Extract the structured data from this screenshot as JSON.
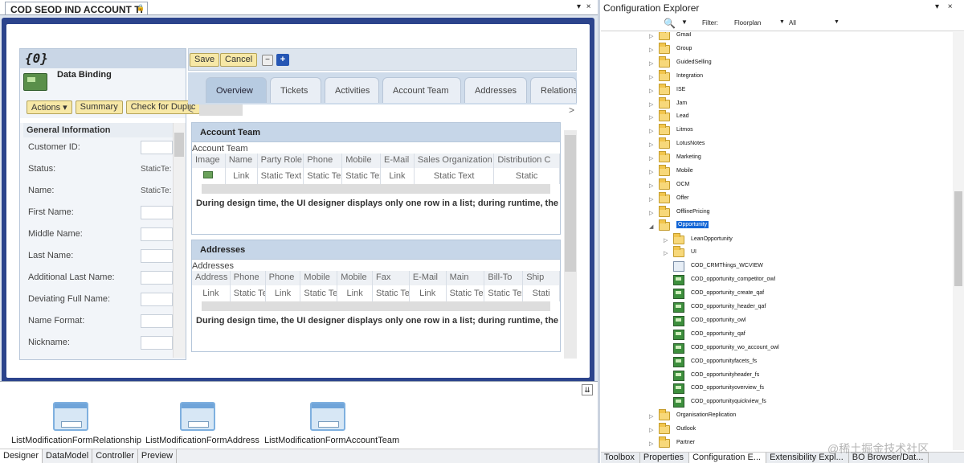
{
  "doc_tab": {
    "title": "COD SEOD IND ACCOUNT TI",
    "pin": "🔒"
  },
  "doc_controls": "▾ ×",
  "binding": {
    "header": "{0}",
    "title": "Data Binding",
    "actions": [
      "Actions ▾",
      "Summary",
      "Check for Duplic"
    ],
    "section": "General Information",
    "fields": [
      {
        "label": "Customer ID:",
        "kind": "box",
        "value": ""
      },
      {
        "label": "Status:",
        "kind": "static",
        "value": "StaticTe:"
      },
      {
        "label": "Name:",
        "kind": "static",
        "value": "StaticTe:"
      },
      {
        "label": "First Name:",
        "kind": "box",
        "value": ""
      },
      {
        "label": "Middle Name:",
        "kind": "box",
        "value": ""
      },
      {
        "label": "Last Name:",
        "kind": "box",
        "value": ""
      },
      {
        "label": "Additional Last Name:",
        "kind": "box",
        "value": ""
      },
      {
        "label": "Deviating Full Name:",
        "kind": "box",
        "value": ""
      },
      {
        "label": "Name Format:",
        "kind": "box",
        "value": ""
      },
      {
        "label": "Nickname:",
        "kind": "box",
        "value": ""
      }
    ]
  },
  "toolbar": {
    "save": "Save",
    "cancel": "Cancel",
    "minus": "−",
    "plus": "+"
  },
  "tabs": [
    "Overview",
    "Tickets",
    "Activities",
    "Account Team",
    "Addresses",
    "Relationsh"
  ],
  "tab_nav": {
    "left": "<",
    "right": ">"
  },
  "account_team": {
    "heading": "Account Team",
    "sub": "Account Team",
    "columns": [
      "Image",
      "Name",
      "Party Role",
      "Phone",
      "Mobile",
      "E-Mail",
      "Sales Organization",
      "Distribution C"
    ],
    "row": [
      "",
      "Link",
      "Static Text",
      "Static Text",
      "Static Text",
      "Link",
      "Static Text",
      "Static"
    ],
    "note": "During design time, the UI designer displays only one row in a list; during runtime, the syst"
  },
  "addresses": {
    "heading": "Addresses",
    "sub": "Addresses",
    "columns": [
      "Address",
      "Phone",
      "Phone",
      "Mobile",
      "Mobile",
      "Fax",
      "E-Mail",
      "Main",
      "Bill-To",
      "Ship"
    ],
    "row": [
      "Link",
      "Static Text",
      "Link",
      "Static Text",
      "Link",
      "Static Text",
      "Link",
      "Static Text",
      "Static Text",
      "Stati"
    ],
    "note": "During design time, the UI designer displays only one row in a list; during runtime, the syst"
  },
  "components": [
    "ListModificationFormRelationship",
    "ListModificationFormAddress",
    "ListModificationFormAccountTeam"
  ],
  "bottom_tabs": [
    "Designer",
    "DataModel",
    "Controller",
    "Preview"
  ],
  "explorer": {
    "title": "Configuration Explorer",
    "controls": "▾ ×",
    "search_icon": "🔍",
    "filter_label": "Filter:",
    "filter_value": "Floorplan",
    "filter2_value": "All",
    "tree": [
      {
        "label": "Gmail",
        "type": "folder",
        "level": 0,
        "tri": "▷"
      },
      {
        "label": "Group",
        "type": "folder",
        "level": 0,
        "tri": "▷"
      },
      {
        "label": "GuidedSelling",
        "type": "folder",
        "level": 0,
        "tri": "▷"
      },
      {
        "label": "Integration",
        "type": "folder",
        "level": 0,
        "tri": "▷"
      },
      {
        "label": "ISE",
        "type": "folder",
        "level": 0,
        "tri": "▷"
      },
      {
        "label": "Jam",
        "type": "folder",
        "level": 0,
        "tri": "▷"
      },
      {
        "label": "Lead",
        "type": "folder",
        "level": 0,
        "tri": "▷"
      },
      {
        "label": "Litmos",
        "type": "folder",
        "level": 0,
        "tri": "▷"
      },
      {
        "label": "LotusNotes",
        "type": "folder",
        "level": 0,
        "tri": "▷"
      },
      {
        "label": "Marketing",
        "type": "folder",
        "level": 0,
        "tri": "▷"
      },
      {
        "label": "Mobile",
        "type": "folder",
        "level": 0,
        "tri": "▷"
      },
      {
        "label": "OCM",
        "type": "folder",
        "level": 0,
        "tri": "▷"
      },
      {
        "label": "Offer",
        "type": "folder",
        "level": 0,
        "tri": "▷"
      },
      {
        "label": "OfflinePricing",
        "type": "folder",
        "level": 0,
        "tri": "▷"
      },
      {
        "label": "Opportunity",
        "type": "folder",
        "level": 0,
        "tri": "◢",
        "selected": true
      },
      {
        "label": "LeanOpportunity",
        "type": "folder",
        "level": 1,
        "tri": "▷"
      },
      {
        "label": "UI",
        "type": "folder",
        "level": 1,
        "tri": "▷"
      },
      {
        "label": "COD_CRMThings_WCVIEW",
        "type": "file",
        "level": 1,
        "tri": ""
      },
      {
        "label": "COD_opportunity_competitor_owl",
        "type": "gfile",
        "level": 1,
        "tri": ""
      },
      {
        "label": "COD_opportunity_create_qaf",
        "type": "gfile",
        "level": 1,
        "tri": ""
      },
      {
        "label": "COD_opportunity_header_qaf",
        "type": "gfile",
        "level": 1,
        "tri": ""
      },
      {
        "label": "COD_opportunity_owl",
        "type": "gfile",
        "level": 1,
        "tri": ""
      },
      {
        "label": "COD_opportunity_qaf",
        "type": "gfile",
        "level": 1,
        "tri": ""
      },
      {
        "label": "COD_opportunity_wo_account_owl",
        "type": "gfile",
        "level": 1,
        "tri": ""
      },
      {
        "label": "COD_opportunityfacets_fs",
        "type": "gfile",
        "level": 1,
        "tri": ""
      },
      {
        "label": "COD_opportunityheader_fs",
        "type": "gfile",
        "level": 1,
        "tri": ""
      },
      {
        "label": "COD_opportunityoverview_fs",
        "type": "gfile",
        "level": 1,
        "tri": ""
      },
      {
        "label": "COD_opportunityquickview_fs",
        "type": "gfile",
        "level": 1,
        "tri": ""
      },
      {
        "label": "OrganisationReplication",
        "type": "folder",
        "level": 0,
        "tri": "▷"
      },
      {
        "label": "Outlook",
        "type": "folder",
        "level": 0,
        "tri": "▷"
      },
      {
        "label": "Partner",
        "type": "folder",
        "level": 0,
        "tri": "▷"
      }
    ],
    "tabs": [
      "Toolbox",
      "Properties",
      "Configuration E...",
      "Extensibility Expl...",
      "BO Browser/Dat..."
    ],
    "highlight_color": "#00ff00"
  },
  "watermark": "@稀土掘金技术社区"
}
